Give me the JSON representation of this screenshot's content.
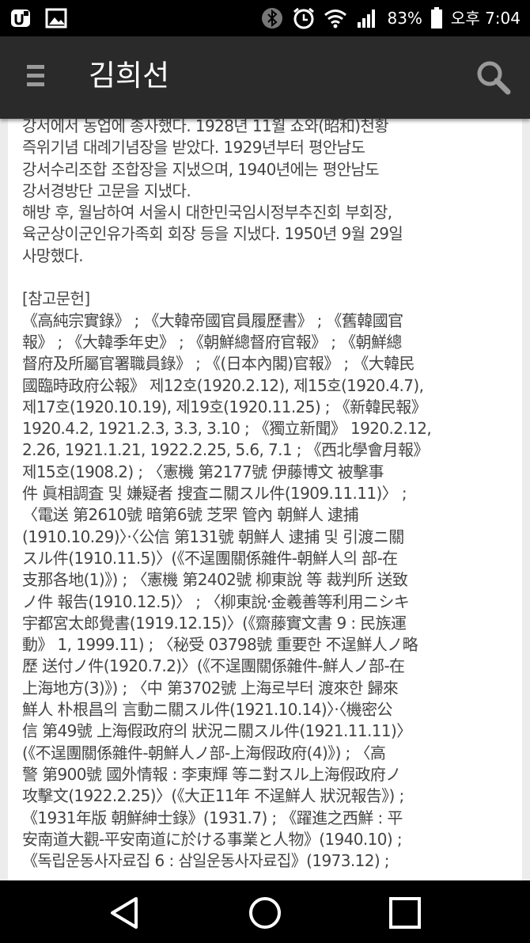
{
  "status_bar": {
    "battery_percent": "83%",
    "time": "오후 7:04",
    "icons": [
      "app-notification-icon",
      "image-icon",
      "bluetooth-icon",
      "alarm-icon",
      "wifi-icon",
      "signal-icon",
      "battery-icon"
    ]
  },
  "app_bar": {
    "title": "김희선",
    "icons": [
      "menu-icon",
      "search-icon"
    ]
  },
  "article": {
    "bio_lines": [
      "강서에서 농업에 종사했다. 1928년 11월 쇼와(昭和)천황",
      "즉위기념 대례기념장을 받았다. 1929년부터 평안남도",
      "강서수리조합 조합장을 지냈으며, 1940년에는 평안남도",
      "강서경방단 고문을 지냈다.",
      "해방 후, 월남하여 서울시 대한민국임시정부추진회 부회장,",
      "육군상이군인유가족회 회장 등을 지냈다. 1950년 9월 29일",
      "사망했다."
    ],
    "references_heading": "[참고문헌]",
    "reference_lines": [
      "《高純宗實錄》 ; 《大韓帝國官員履歷書》 ; 《舊韓國官",
      "報》 ; 《大韓季年史》 ; 《朝鮮總督府官報》 ; 《朝鮮總",
      "督府及所屬官署職員錄》 ; 《(日本內閣)官報》 ; 《大韓民",
      "國臨時政府公報》 제12호(1920.2.12), 제15호(1920.4.7),",
      "제17호(1920.10.19), 제19호(1920.11.25) ; 《新韓民報》",
      "1920.4.2, 1921.2.3, 3.3, 3.10 ; 《獨立新聞》 1920.2.12,",
      "2.26, 1921.1.21, 1922.2.25, 5.6, 7.1 ; 《西北學會月報》",
      "제15호(1908.2) ; 〈憲機 第2177號 伊藤博文 被擊事",
      "件 眞相調査 및 嫌疑者 搜査ニ關スル件(1909.11.11)〉 ;",
      "〈電送 第2610號 暗第6號 芝罘 管內 朝鮮人 逮捕",
      "(1910.10.29)〉·〈公信 第131號 朝鮮人 逮捕 및 引渡ニ關",
      "スル件(1910.11.5)〉(《不逞團關係雜件-朝鮮人의 部-在",
      "支那各地(1)》) ; 〈憲機 第2402號 柳東說 等 裁判所 送致",
      "ノ件 報告(1910.12.5)〉 ; 〈柳東說·金羲善等利用ニシキ",
      "宇都宮太郎覺書(1919.12.15)〉(《齋藤實文書 9 : 民族運",
      "動》 1, 1999.11) ; 〈秘受 03798號 重要한 不逞鮮人ノ略",
      "歷 送付ノ件(1920.7.2)〉(《不逞團關係雜件-鮮人ノ部-在",
      "上海地方(3)》) ; 〈中 第3702號 上海로부터 渡來한 歸來",
      "鮮人 朴根昌의 言動ニ關スル件(1921.10.14)〉·〈機密公",
      "信 第49號 上海假政府의 狀況ニ關スル件(1921.11.11)〉",
      "(《不逞團關係雜件-朝鮮人ノ部-上海假政府(4)》) ; 〈高",
      "警 第900號 國外情報 : 李東輝 等ニ對スル上海假政府ノ",
      "攻擊文(1922.2.25)〉(《大正11年 不逞鮮人 狀況報告》) ;",
      "《1931年版 朝鮮紳士錄》(1931.7) ; 《躍進之西鮮 : 平",
      "安南道大觀-平安南道に於ける事業と人物》(1940.10) ;",
      "《독립운동사자료집 6 : 삼일운동사자료집》(1973.12) ;"
    ]
  },
  "nav_bar": {
    "icons": [
      "back-icon",
      "home-icon",
      "recents-icon"
    ]
  }
}
